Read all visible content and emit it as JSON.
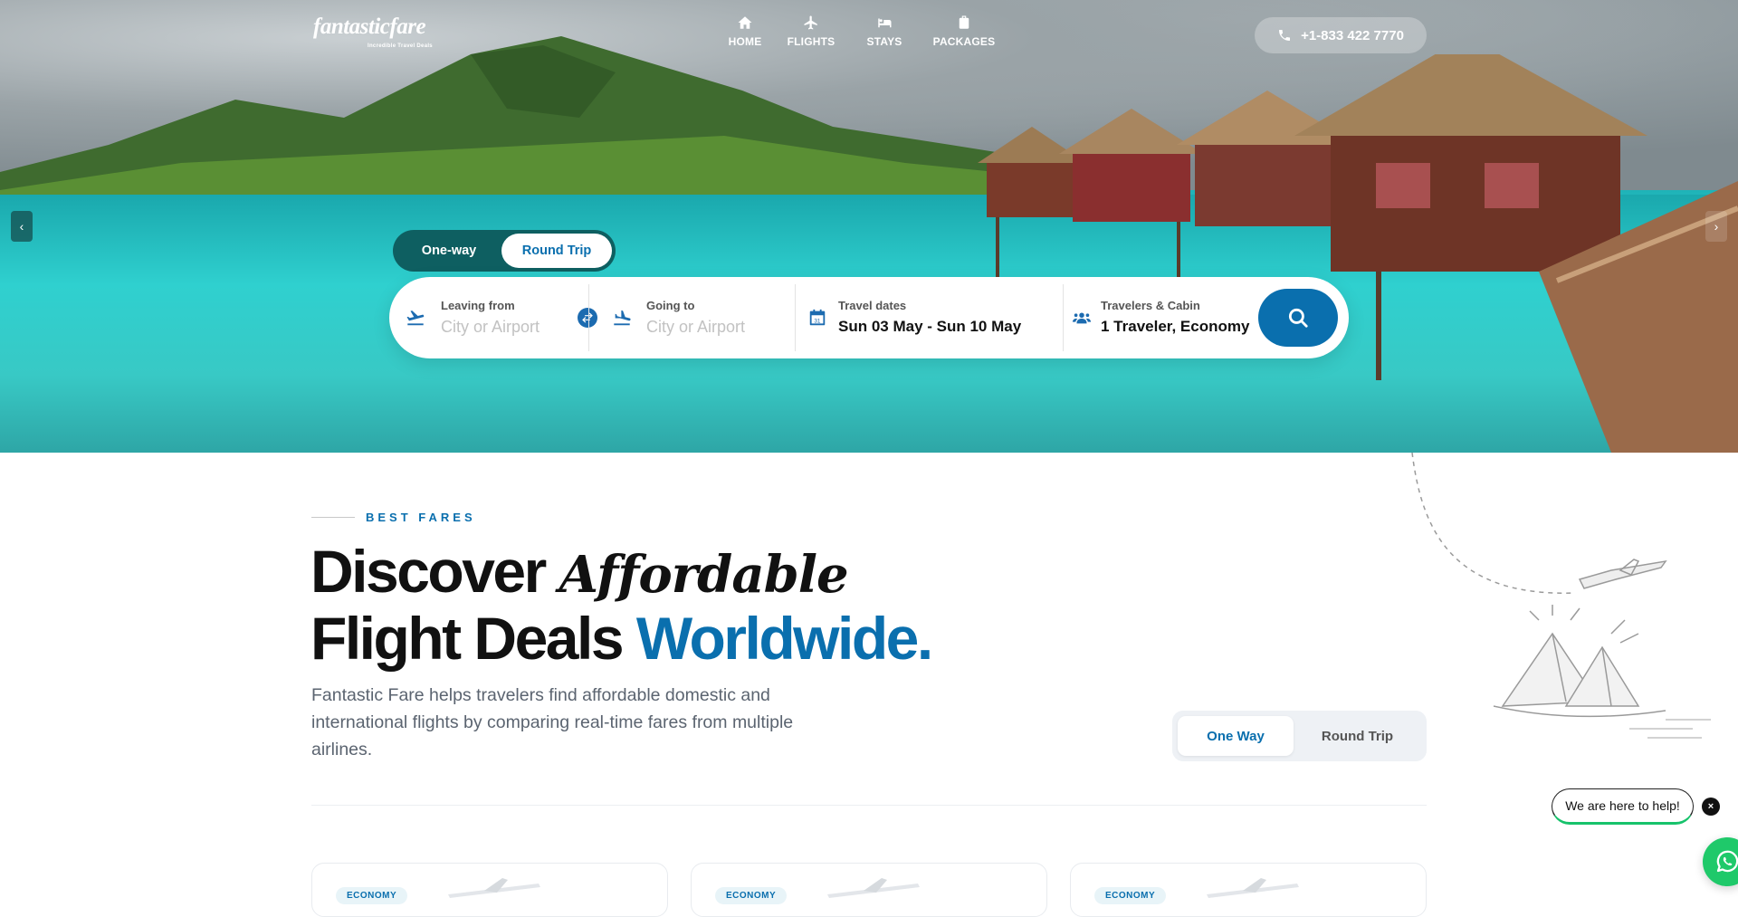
{
  "header": {
    "logo_text": "fantasticfare",
    "logo_tagline": "Incredible Travel Deals",
    "nav": [
      {
        "label": "HOME",
        "icon": "home-icon"
      },
      {
        "label": "FLIGHTS",
        "icon": "plane-icon"
      },
      {
        "label": "STAYS",
        "icon": "bed-icon"
      },
      {
        "label": "PACKAGES",
        "icon": "luggage-icon"
      }
    ],
    "phone": "+1-833 422 7770"
  },
  "hero": {
    "trip_type": {
      "one_way": "One-way",
      "round_trip": "Round Trip",
      "selected": "Round Trip"
    },
    "search": {
      "leaving_label": "Leaving from",
      "leaving_placeholder": "City or Airport",
      "going_label": "Going to",
      "going_placeholder": "City or Airport",
      "dates_label": "Travel dates",
      "dates_value": "Sun 03 May - Sun 10 May",
      "travelers_label": "Travelers & Cabin",
      "travelers_value": "1 Traveler, Economy"
    },
    "prev_arrow": "‹",
    "next_arrow": "›"
  },
  "main": {
    "eyebrow": "BEST FARES",
    "headline": {
      "part1": "Discover ",
      "part1_italic": "Affordable",
      "part2": "Flight Deals ",
      "part2_blue": "Worldwide."
    },
    "description": "Fantastic Fare helps travelers find affordable domestic and international flights by comparing real-time fares from multiple airlines.",
    "fare_toggle": {
      "one_way": "One Way",
      "round_trip": "Round Trip",
      "selected": "One Way"
    },
    "cards": [
      {
        "badge": "ECONOMY"
      },
      {
        "badge": "ECONOMY"
      },
      {
        "badge": "ECONOMY"
      }
    ]
  },
  "help": {
    "bubble_text": "We are here to help!",
    "close": "×"
  },
  "colors": {
    "brand_blue": "#0a6fae",
    "whatsapp_green": "#1fc96a"
  }
}
